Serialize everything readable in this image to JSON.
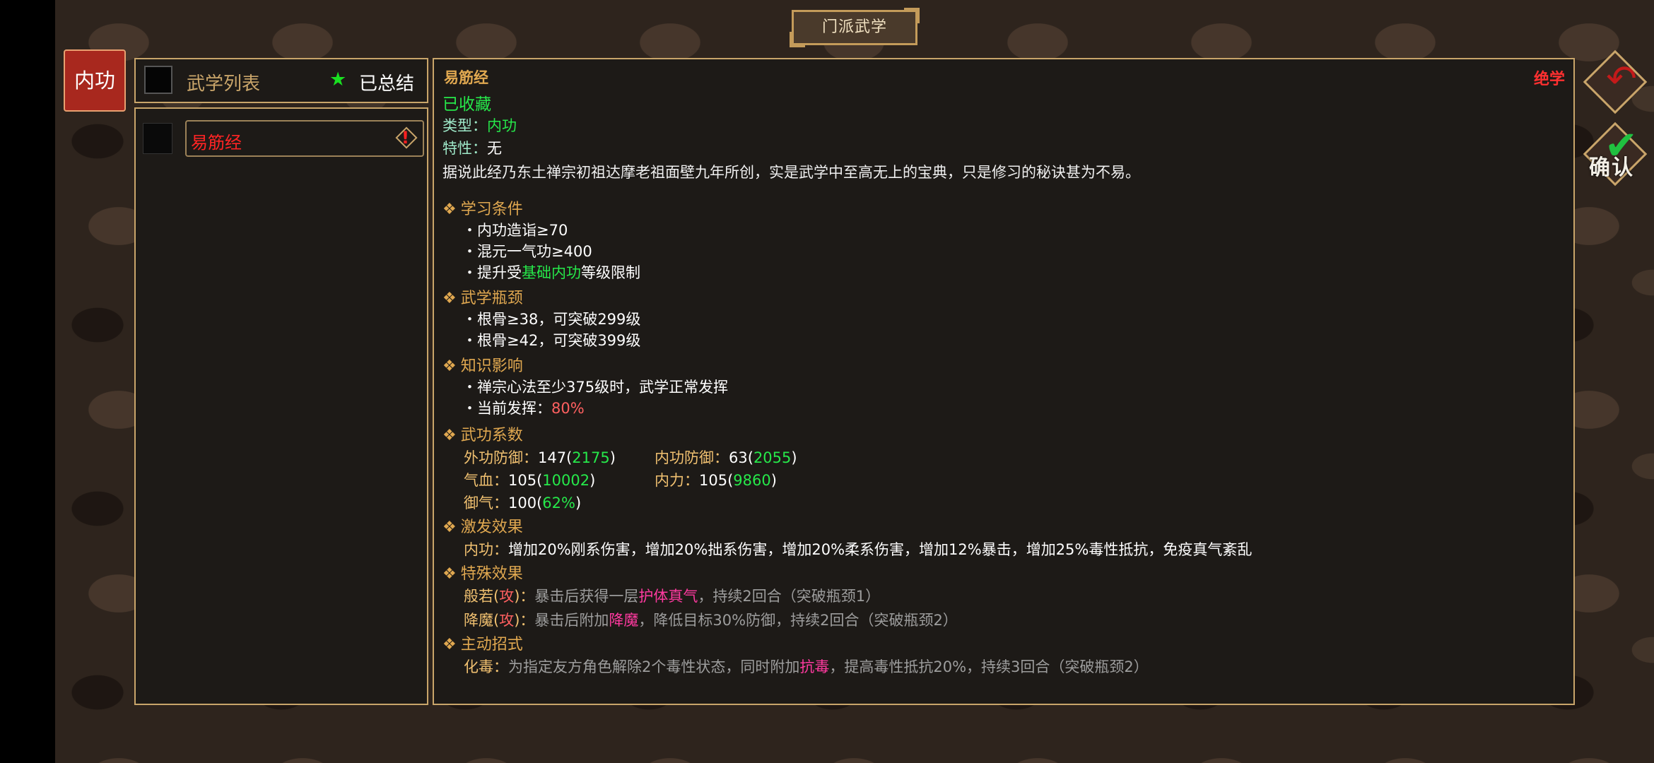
{
  "header": {
    "title": "门派武学"
  },
  "category_tab": {
    "label": "内功"
  },
  "list": {
    "title": "武学列表",
    "summary_label": "已总结",
    "items": [
      {
        "name": "易筋经"
      }
    ]
  },
  "detail": {
    "name": "易筋经",
    "rarity": "绝学",
    "collected": "已收藏",
    "type_label": "类型：",
    "type_value": "内功",
    "trait_label": "特性：",
    "trait_value": "无",
    "description": "据说此经乃东土禅宗初祖达摩老祖面壁九年所创，实是武学中至高无上的宝典，只是修习的秘诀甚为不易。",
    "diamond": "❖",
    "bullet": "・",
    "sections": {
      "learn": {
        "title": "学习条件",
        "lines": [
          "内功造诣≥70",
          "混元一气功≥400"
        ],
        "line3_prefix": "提升受",
        "line3_highlight": "基础内功",
        "line3_suffix": "等级限制"
      },
      "bottleneck": {
        "title": "武学瓶颈",
        "lines": [
          "根骨≥38，可突破299级",
          "根骨≥42，可突破399级"
        ]
      },
      "knowledge": {
        "title": "知识影响",
        "line1": "禅宗心法至少375级时，武学正常发挥",
        "line2_prefix": "当前发挥：",
        "line2_value": "80%"
      },
      "coeff": {
        "title": "武功系数",
        "outer_def_label": "外功防御：",
        "outer_def_value": "147",
        "outer_def_total": "2175",
        "inner_def_label": "内功防御：",
        "inner_def_value": "63",
        "inner_def_total": "2055",
        "hp_label": "气血：",
        "hp_value": "105",
        "hp_total": "10002",
        "mp_label": "内力：",
        "mp_value": "105",
        "mp_total": "9860",
        "yuqi_label": "御气：",
        "yuqi_value": "100",
        "yuqi_total": "62%"
      },
      "trigger": {
        "title": "激发效果",
        "label": "内功：",
        "text": "增加20%刚系伤害，增加20%拙系伤害，增加20%柔系伤害，增加12%暴击，增加25%毒性抵抗，免疫真气紊乱"
      },
      "special": {
        "title": "特殊效果",
        "e1_name": "般若",
        "e1_tag": "攻",
        "e1_pre": "暴击后获得一层",
        "e1_hl": "护体真气",
        "e1_post": "，持续2回合（突破瓶颈1）",
        "e2_name": "降魔",
        "e2_tag": "攻",
        "e2_pre": "暴击后附加",
        "e2_hl": "降魔",
        "e2_post": "，降低目标30%防御，持续2回合（突破瓶颈2）"
      },
      "active": {
        "title": "主动招式",
        "name": "化毒：",
        "pre": "为指定友方角色解除2个毒性状态，同时附加",
        "hl": "抗毒",
        "post": "，提高毒性抵抗20%，持续3回合（突破瓶颈2）"
      }
    }
  },
  "controls": {
    "confirm_label": "确认"
  },
  "colors": {
    "accent_gold": "#c9a56a",
    "tab_red": "#a8281e",
    "highlight_green": "#26e84a",
    "rarity_red": "#ff3030",
    "effect_pink": "#ff3aa0"
  }
}
